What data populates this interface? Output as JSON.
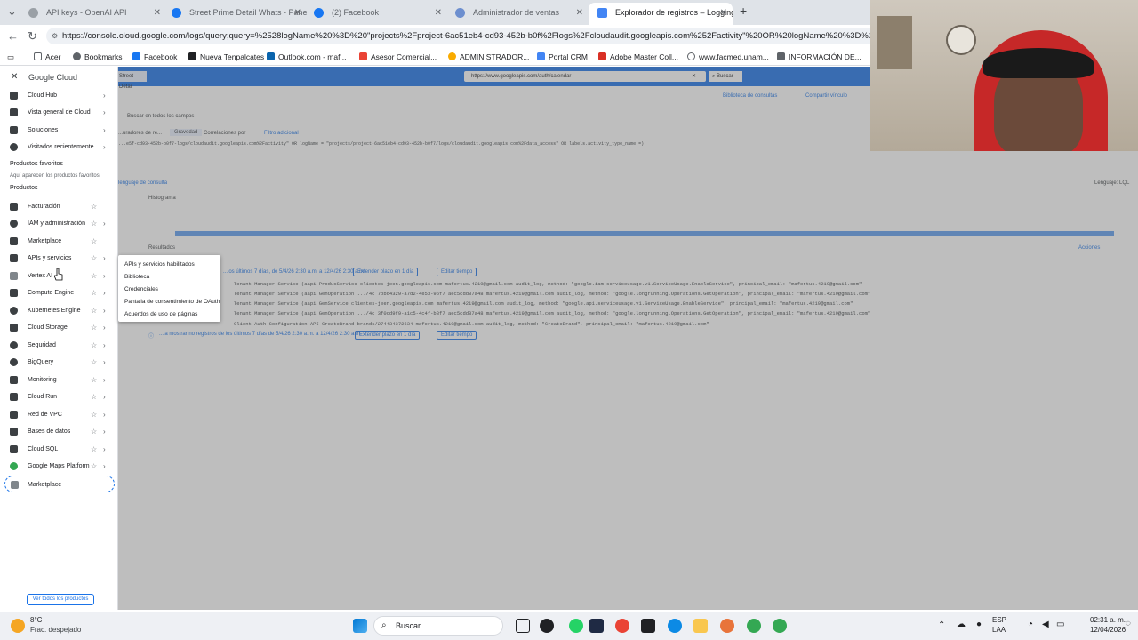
{
  "browser": {
    "tabs": [
      {
        "label": "API keys - OpenAI API",
        "color": "#8e8e8e"
      },
      {
        "label": "Street Prime Detail Whats - Pane",
        "color": "#1877f2"
      },
      {
        "label": "(2) Facebook",
        "color": "#1877f2"
      },
      {
        "label": "Administrador de ventas",
        "color": "#5b7fbf"
      },
      {
        "label": "Explorador de registros – Logging",
        "color": "#4285f4"
      }
    ],
    "new_tab": "+",
    "url": "https://console.cloud.google.com/logs/query;query=%2528logName%20%3D%20\"projects%2Fproject-6ac51eb4-cd93-452b-b0f%2Flogs%2Fcloudaudit.googleapis.com%252Factivity\"%20OR%20logName%20%3D%20\"pro",
    "bookmarks": [
      "Acer",
      "Bookmarks",
      "Facebook",
      "Nueva Tenpalcates",
      "Outlook.com - maf...",
      "Asesor Comercial...",
      "ADMINISTRADOR...",
      "Portal CRM",
      "Adobe Master Coll...",
      "www.facmed.unam...",
      "INFORMACIÓN DE..."
    ]
  },
  "page": {
    "search_box": "https://www.googleapis.com/auth/calendar",
    "search_btn": "Buscar",
    "tab_fragment": "Street Detail",
    "library_link": "Biblioteca de consultas",
    "share_link": "Compartir vínculo",
    "search_all": "Buscar en todos los campos",
    "filters": [
      "...uradores de re...",
      "Gravedad",
      "Correlaciones por",
      "Filtro adicional"
    ],
    "query_line": "...e5f-cd93-452b-b0f7-logs/cloudaudit.googleapis.com%2Factivity\" OR logName = \"projects/project-6ac51eb4-cd93-452b-b0f7/logs/cloudaudit.googleapis.com%2Fdata_access\" OR labels.activity_type_name =)",
    "query_lang_link": "lenguaje de consulta",
    "language": "Lenguaje: LQL",
    "histogram_label": "Histograma",
    "results_label": "Resultados",
    "actions": "Acciones",
    "results_header": "...los últimos 7 días, de 5/4/26 2:30 a.m. a 12/4/26 2:30 a.m.",
    "extend_chip": "Extender plazo en 1 día",
    "edit_time": "Editar tiempo",
    "log_rows": [
      "Tenant Manager Service (aapi   ProducService   clientes-jeen.googleapis.com   mafertus.4219@gmail.com   audit_log, method: \"google.iam.serviceusage.v1.ServiceUsage.EnableService\", principal_email: \"mafertus.4219@gmail.com\"",
      "Tenant Manager Service (aapi   GenOperation   .../4c 7bbd4329-a7d2-4e53-96f7 aec5cdd87a48   mafertus.4219@gmail.com   audit_log, method: \"google.longrunning.Operations.GetOperation\", principal_email: \"mafertus.4219@gmail.com\"",
      "Tenant Manager Service (aapi   GenService   clientes-jeen.googleapis.com   mafertus.4219@gmail.com   audit_log, method: \"google.api.serviceusage.v1.ServiceUsage.EnableService\", principal_email: \"mafertus.4219@gmail.com\"",
      "Tenant Manager Service (aapi   GenOperation   .../4c 3f0cd9f9-a1c5-4c4f-b8f7 aec5cdd87a48   mafertus.4219@gmail.com   audit_log, method: \"google.longrunning.Operations.GetOperation\", principal_email: \"mafertus.4219@gmail.com\"",
      "Client Auth Configuration API   CreateBrand   brands/274434372634   mafertus.4219@gmail.com   audit_log, method: \"CreateBrand\", principal_email: \"mafertus.4219@gmail.com\""
    ],
    "footer_note": "...la mostrar no registros de los últimos 7 días de 5/4/26 2:30 a.m. a 12/4/26 2:30 a.m.",
    "footer_extend": "Extender plazo en 1 día",
    "footer_edit": "Editar tiempo"
  },
  "sidenav": {
    "logo": "Google Cloud",
    "top_items": [
      "Cloud Hub",
      "Vista general de Cloud",
      "Soluciones",
      "Visitados recientemente"
    ],
    "favorites_title": "Productos favoritos",
    "favorites_hint": "Aquí aparecen los productos favoritos",
    "products_title": "Productos",
    "products": [
      "Facturación",
      "IAM y administración",
      "Marketplace",
      "APIs y servicios",
      "Vertex AI",
      "Compute Engine",
      "Kubernetes Engine",
      "Cloud Storage",
      "Seguridad",
      "BigQuery",
      "Monitoring",
      "Cloud Run",
      "Red de VPC",
      "Bases de datos",
      "Cloud SQL",
      "Google Maps Platform"
    ],
    "highlighted": "Marketplace",
    "view_all": "Ver todos los productos",
    "flyout": [
      "APIs y servicios habilitados",
      "Biblioteca",
      "Credenciales",
      "Pantalla de consentimiento de OAuth",
      "Acuerdos de uso de páginas"
    ]
  },
  "taskbar": {
    "weather_temp": "8°C",
    "weather_desc": "Frac. despejado",
    "search": "Buscar",
    "lang1": "ESP",
    "lang2": "LAA",
    "time": "02:31 a. m.",
    "date": "12/04/2026"
  }
}
